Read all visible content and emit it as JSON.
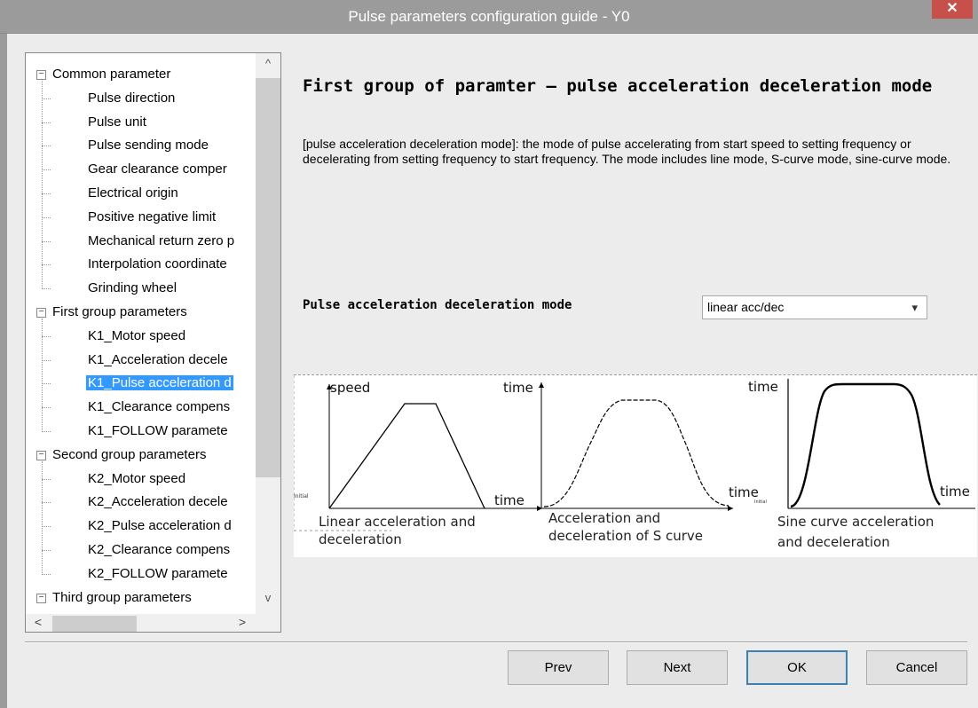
{
  "window": {
    "title": "Pulse parameters configuration guide - Y0",
    "close_icon": "close-icon"
  },
  "tree": {
    "groups": [
      {
        "label": "Common parameter",
        "items": [
          "Pulse direction",
          "Pulse unit",
          "Pulse sending mode",
          "Gear clearance comper",
          "Electrical origin",
          "Positive negative limit",
          "Mechanical return zero p",
          "Interpolation coordinate",
          "Grinding wheel"
        ]
      },
      {
        "label": "First group parameters",
        "items": [
          "K1_Motor speed",
          "K1_Acceleration decele",
          "K1_Pulse acceleration d",
          "K1_Clearance compens",
          "K1_FOLLOW paramete"
        ]
      },
      {
        "label": "Second group parameters",
        "items": [
          "K2_Motor speed",
          "K2_Acceleration decele",
          "K2_Pulse acceleration d",
          "K2_Clearance compens",
          "K2_FOLLOW paramete"
        ]
      },
      {
        "label": "Third group parameters",
        "items": []
      }
    ],
    "selected": "K1_Pulse acceleration d"
  },
  "content": {
    "heading": "First group of paramter – pulse acceleration deceleration mode",
    "description": "[pulse acceleration deceleration mode]: the mode of pulse accelerating from start speed to setting frequency or decelerating from setting frequency to start frequency. The mode includes line mode, S-curve mode, sine-curve mode.",
    "mode_label": "Pulse acceleration deceleration mode",
    "mode_value": "linear acc/dec"
  },
  "diagrams": {
    "linear": {
      "y_label": "speed",
      "x_label": "time",
      "caption_line1": "Linear acceleration and",
      "caption_line2": "deceleration"
    },
    "s_curve": {
      "y_label": "time",
      "x_label": "time",
      "caption_line1": "Acceleration and",
      "caption_line2": "deceleration of S curve"
    },
    "sine": {
      "y_label": "time",
      "x_label": "time",
      "caption_line1": "Sine curve acceleration",
      "caption_line2": "and deceleration"
    }
  },
  "buttons": {
    "prev": "Prev",
    "next": "Next",
    "ok": "OK",
    "cancel": "Cancel"
  }
}
